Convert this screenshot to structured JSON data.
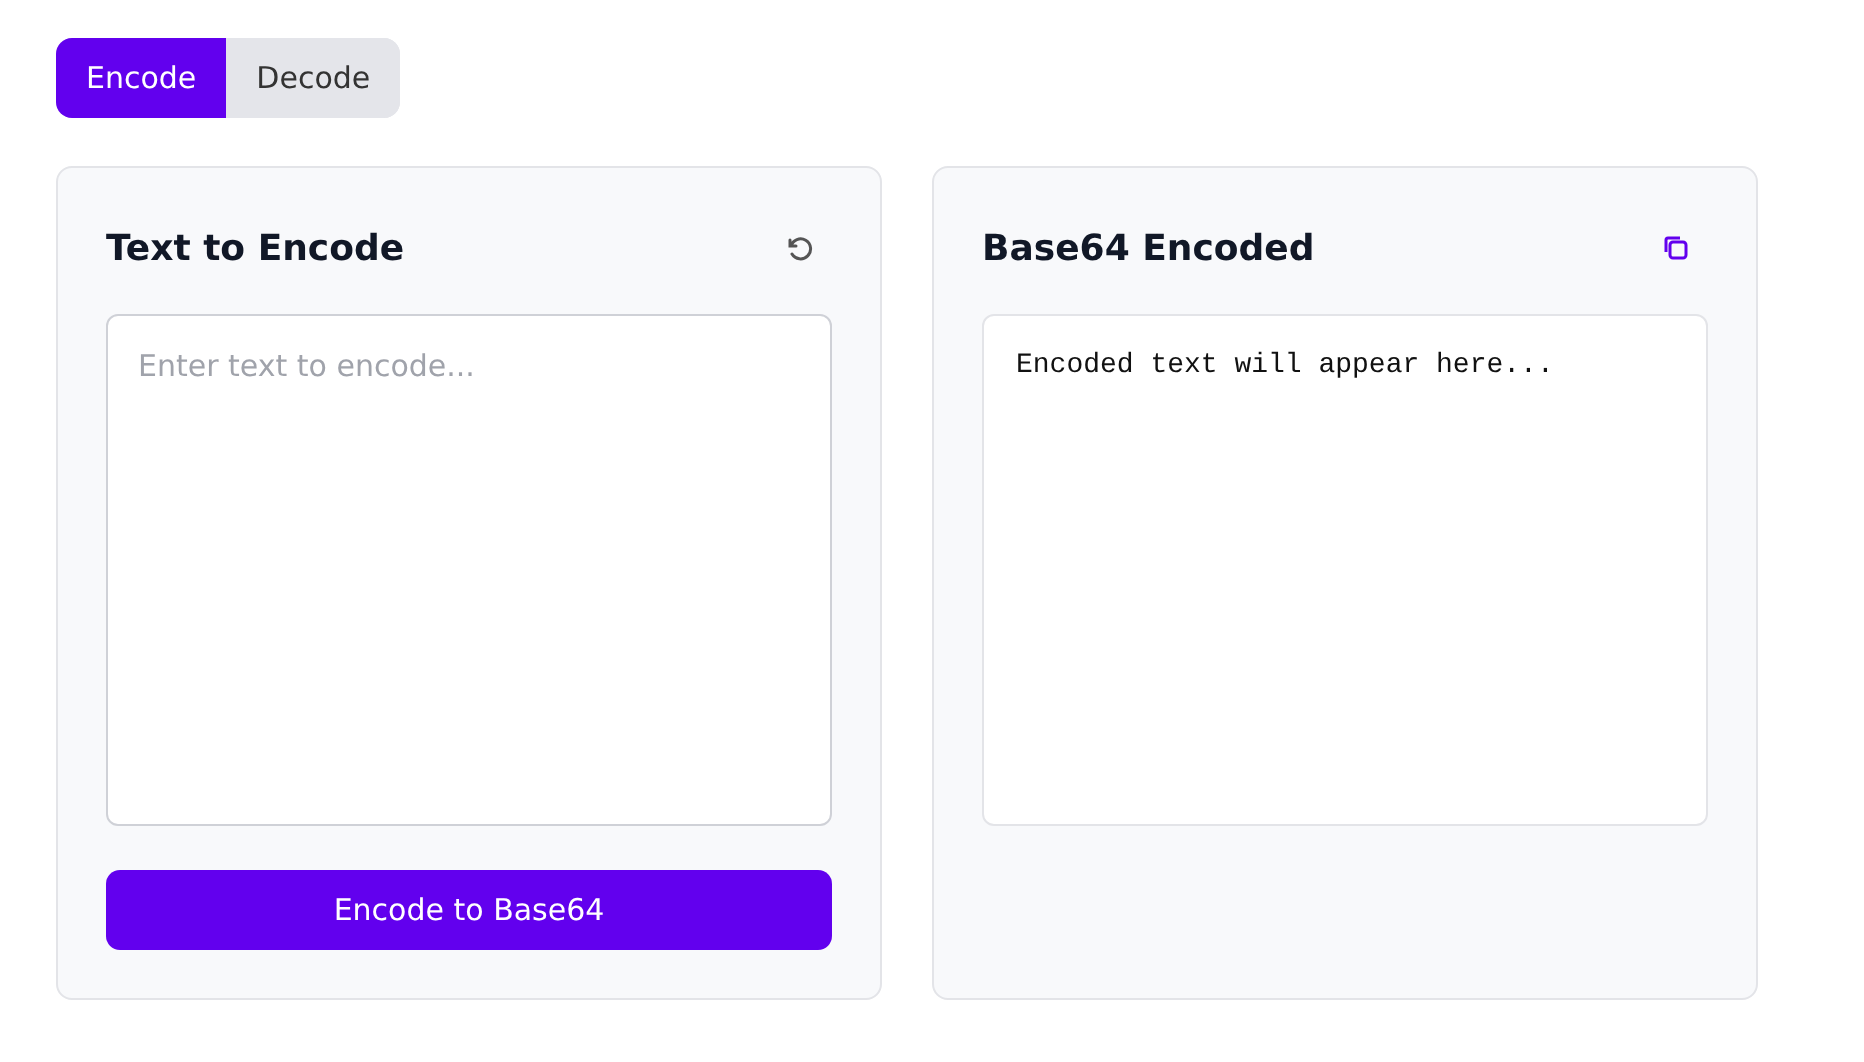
{
  "tabs": [
    {
      "label": "Encode",
      "selected": true
    },
    {
      "label": "Decode",
      "selected": false
    }
  ],
  "input_panel": {
    "title": "Text to Encode",
    "placeholder": "Enter text to encode...",
    "button": "Encode to Base64"
  },
  "output_panel": {
    "title": "Base64 Encoded",
    "output_text": "Encoded text will appear here..."
  }
}
